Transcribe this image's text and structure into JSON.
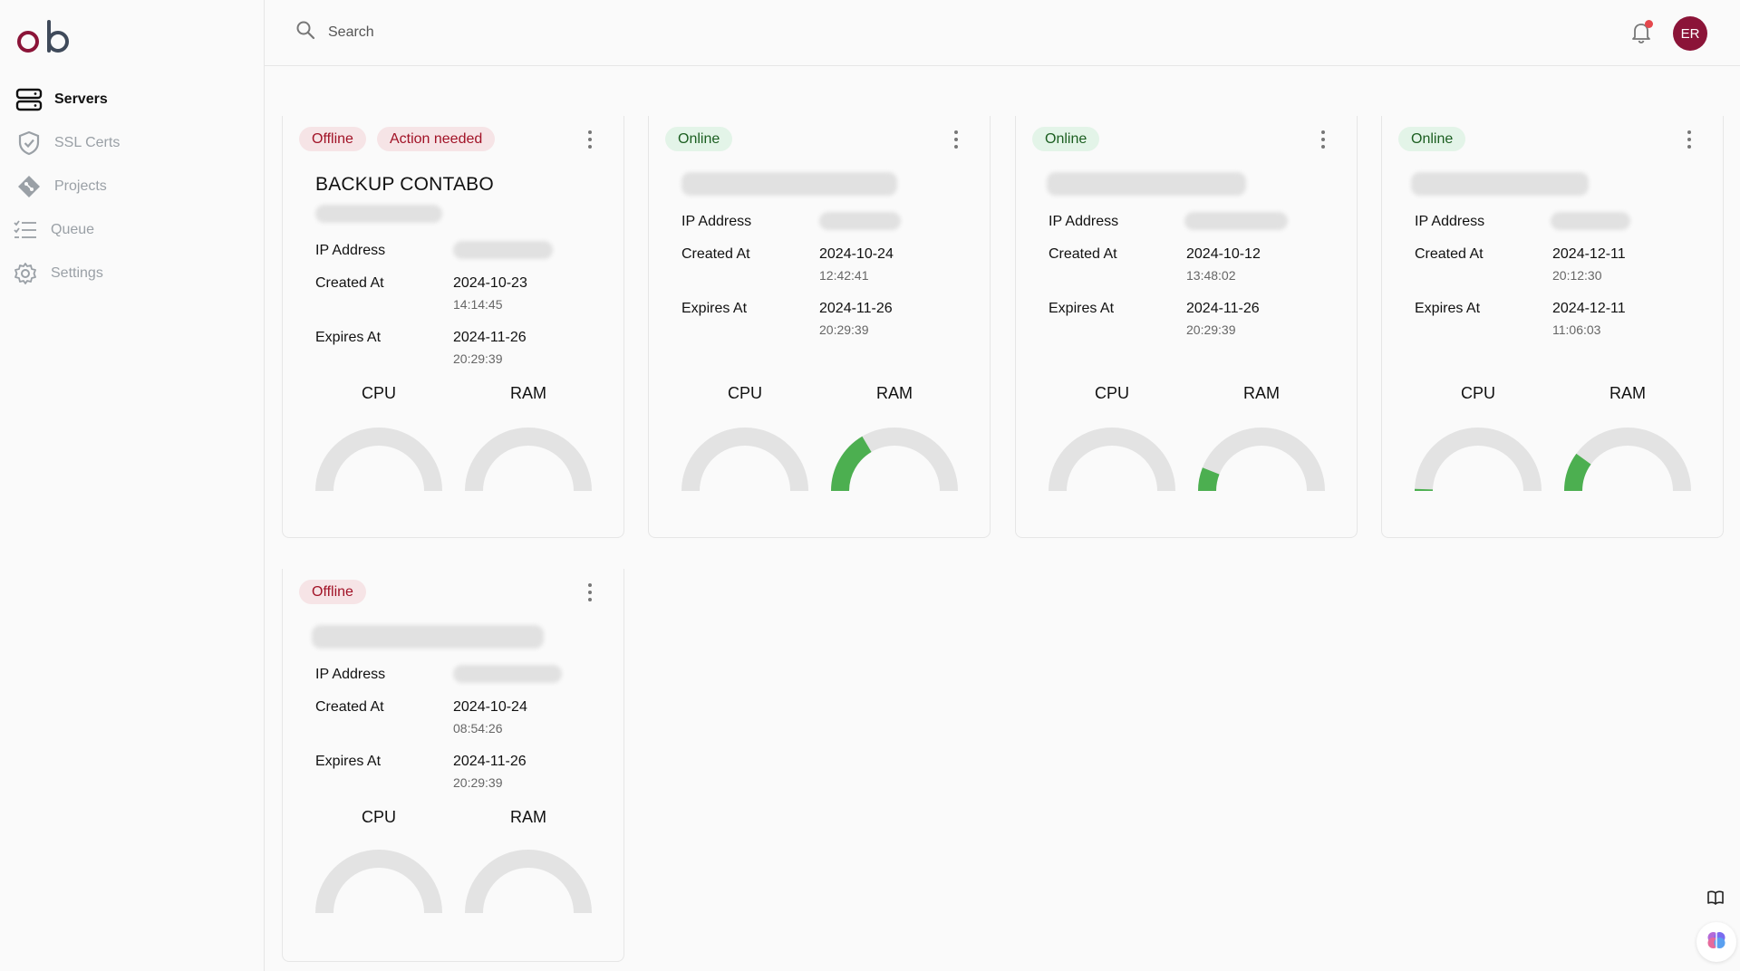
{
  "app": {
    "logo_text": "ob"
  },
  "sidebar": {
    "items": [
      {
        "label": "Servers",
        "icon": "server-icon",
        "active": true
      },
      {
        "label": "SSL Certs",
        "icon": "shield-check-icon",
        "active": false
      },
      {
        "label": "Projects",
        "icon": "git-diamond-icon",
        "active": false
      },
      {
        "label": "Queue",
        "icon": "checklist-icon",
        "active": false
      },
      {
        "label": "Settings",
        "icon": "gear-icon",
        "active": false
      }
    ]
  },
  "header": {
    "search_placeholder": "Search",
    "avatar_initials": "ER",
    "bell_icon": "bell-icon"
  },
  "labels": {
    "ip_address": "IP Address",
    "created_at": "Created At",
    "expires_at": "Expires At",
    "cpu": "CPU",
    "ram": "RAM"
  },
  "colors": {
    "offline_bg": "#f6e4e6",
    "offline_text": "#a11226",
    "online_bg": "#e3f4e8",
    "online_text": "#1b5e20",
    "gauge_track": "#e3e3e3",
    "gauge_fill": "#4caf50",
    "avatar_bg": "#8b1438"
  },
  "servers": [
    {
      "status": "Offline",
      "extra_badge": "Action needed",
      "name": "BACKUP CONTABO",
      "created_date": "2024-10-23",
      "created_time": "14:14:45",
      "expires_date": "2024-11-26",
      "expires_time": "20:29:39",
      "cpu_usage": 0,
      "ram_usage": 0
    },
    {
      "status": "Online",
      "name": "",
      "created_date": "2024-10-24",
      "created_time": "12:42:41",
      "expires_date": "2024-11-26",
      "expires_time": "20:29:39",
      "cpu_usage": 0,
      "ram_usage": 0.33
    },
    {
      "status": "Online",
      "name": "",
      "created_date": "2024-10-12",
      "created_time": "13:48:02",
      "expires_date": "2024-11-26",
      "expires_time": "20:29:39",
      "cpu_usage": 0,
      "ram_usage": 0.12
    },
    {
      "status": "Online",
      "name": "",
      "created_date": "2024-12-11",
      "created_time": "20:12:30",
      "expires_date": "2024-12-11",
      "expires_time": "11:06:03",
      "cpu_usage": 0.01,
      "ram_usage": 0.2
    },
    {
      "status": "Offline",
      "name": "",
      "created_date": "2024-10-24",
      "created_time": "08:54:26",
      "expires_date": "2024-11-26",
      "expires_time": "20:29:39",
      "cpu_usage": 0,
      "ram_usage": 0
    }
  ]
}
